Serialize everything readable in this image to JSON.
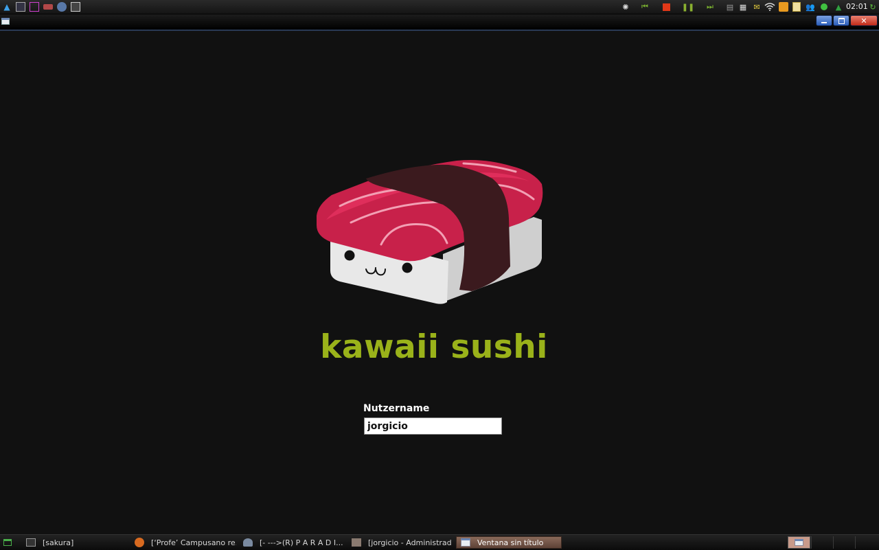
{
  "top_panel": {
    "launchers": [
      "menu-icon",
      "terminal-icon",
      "paint-icon",
      "folder-icon",
      "browser-icon",
      "video-icon"
    ],
    "media_controls": [
      "rec-icon",
      "previous-icon",
      "stop-icon",
      "pause-icon",
      "next-icon"
    ],
    "tray_icons": [
      "window-list-icon",
      "screenshot-icon",
      "mail-icon",
      "wifi-icon",
      "rss-icon",
      "notes-icon",
      "users-icon",
      "status-icon",
      "tree-icon"
    ],
    "clock": "02:01"
  },
  "window": {
    "title": ""
  },
  "login": {
    "theme_title": "kawaii sushi",
    "username_label": "Nutzername",
    "username_value": "jorgicio"
  },
  "taskbar": {
    "tasks": [
      {
        "label": "[sakura]",
        "icon": "terminal-icon"
      },
      {
        "label": "[‘Profe’ Campusano re...",
        "icon": "firefox-icon"
      },
      {
        "label": "[-   --->(R)   P A R A D I...",
        "icon": "chat-icon"
      },
      {
        "label": "[jorgicio - Administrad...",
        "icon": "home-folder-icon"
      },
      {
        "label": "Ventana sin título",
        "icon": "window-icon",
        "active": true
      }
    ],
    "pager": [
      "workspace-1",
      "workspace-2",
      "workspace-3",
      "workspace-4"
    ]
  },
  "colors": {
    "background": "#111111",
    "title_green": "#9ab21a",
    "tuna": "#c8214a",
    "nori": "#3b1a1e"
  }
}
